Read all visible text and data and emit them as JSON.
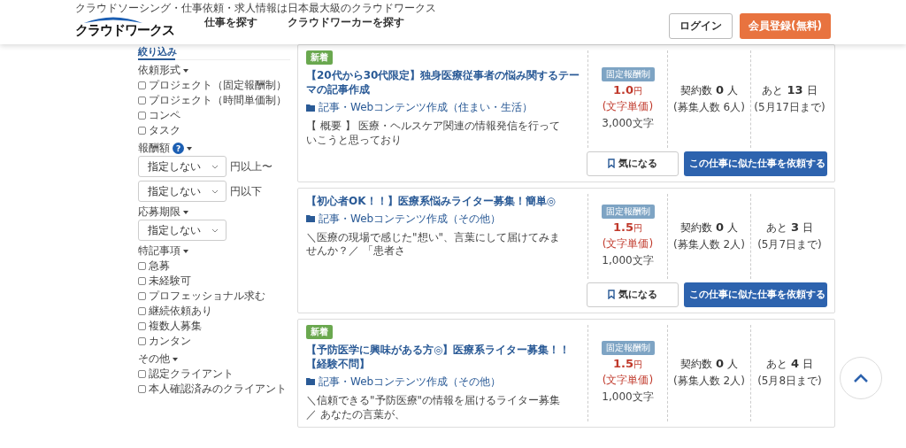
{
  "header": {
    "tagline": "クラウドソーシング・仕事依頼・求人情報は日本最大級のクラウドワークス",
    "logo": "クラウドワークス",
    "nav": [
      "仕事を探す",
      "クラウドワーカーを探す"
    ],
    "login": "ログイン",
    "register": "会員登録(無料)"
  },
  "sidebar": {
    "title": "絞り込み",
    "sections": [
      {
        "heading": "依頼形式",
        "kind": "checks",
        "items": [
          {
            "label": "プロジェクト（固定報酬制）",
            "checked": false
          },
          {
            "label": "プロジェクト（時間単価制）",
            "checked": false
          },
          {
            "label": "コンペ",
            "checked": false
          },
          {
            "label": "タスク",
            "checked": false
          }
        ]
      },
      {
        "heading": "報酬額",
        "help": "?",
        "kind": "selects",
        "selects": [
          {
            "value": "指定しない",
            "suffix": "円以上〜"
          },
          {
            "value": "指定しない",
            "suffix": "円以下"
          }
        ]
      },
      {
        "heading": "応募期限",
        "kind": "selects",
        "selects": [
          {
            "value": "指定しない"
          }
        ]
      },
      {
        "heading": "特記事項",
        "kind": "checks",
        "items": [
          {
            "label": "急募",
            "checked": false
          },
          {
            "label": "未経験可",
            "checked": false
          },
          {
            "label": "プロフェッショナル求む",
            "checked": false
          },
          {
            "label": "継続依頼あり",
            "checked": false
          },
          {
            "label": "複数人募集",
            "checked": false
          },
          {
            "label": "カンタン",
            "checked": false
          }
        ]
      },
      {
        "heading": "その他",
        "kind": "checks",
        "items": [
          {
            "label": "認定クライアント",
            "checked": false
          },
          {
            "label": "本人確認済みのクライアント",
            "checked": false
          }
        ]
      }
    ]
  },
  "jobs": [
    {
      "badge": "新着",
      "title": "【20代から30代限定】独身医療従事者の悩み関するテーマの記事作成",
      "category": "記事・Webコンテンツ作成（住まい・生活）",
      "summary": "【 概要 】 医療・ヘルスケア関連の情報発信を行っていこうと思っており",
      "pay_type": "固定報酬制",
      "price": "1.0",
      "price_unit": "円",
      "price_note": "(文字単価)",
      "volume": "3,000文字",
      "contracts_label": "契約数",
      "contracts": "0",
      "contracts_unit": "人",
      "recruit": "(募集人数 6人)",
      "remaining_label": "あと",
      "days": "13",
      "days_unit": "日",
      "deadline": "(5月17日まで)",
      "bookmark": "気になる",
      "request": "この仕事に似た仕事を依頼する"
    },
    {
      "title": "【初心者OK！！】医療系悩みライター募集！簡単◎",
      "category": "記事・Webコンテンツ作成（その他）",
      "summary": "＼医療の現場で感じた\"想い\"、言葉にして届けてみませんか？／ 「患者さ",
      "pay_type": "固定報酬制",
      "price": "1.5",
      "price_unit": "円",
      "price_note": "(文字単価)",
      "volume": "1,000文字",
      "contracts_label": "契約数",
      "contracts": "0",
      "contracts_unit": "人",
      "recruit": "(募集人数 2人)",
      "remaining_label": "あと",
      "days": "3",
      "days_unit": "日",
      "deadline": "(5月7日まで)",
      "bookmark": "気になる",
      "request": "この仕事に似た仕事を依頼する"
    },
    {
      "badge": "新着",
      "title": "【予防医学に興味がある方◎】医療系ライター募集！！【経験不問】",
      "category": "記事・Webコンテンツ作成（その他）",
      "summary": "＼信頼できる\"予防医療\"の情報を届けるライター募集／ あなたの言葉が、",
      "pay_type": "固定報酬制",
      "price": "1.5",
      "price_unit": "円",
      "price_note": "(文字単価)",
      "volume": "1,000文字",
      "contracts_label": "契約数",
      "contracts": "0",
      "contracts_unit": "人",
      "recruit": "(募集人数 2人)",
      "remaining_label": "あと",
      "days": "4",
      "days_unit": "日",
      "deadline": "(5月8日まで)"
    }
  ]
}
